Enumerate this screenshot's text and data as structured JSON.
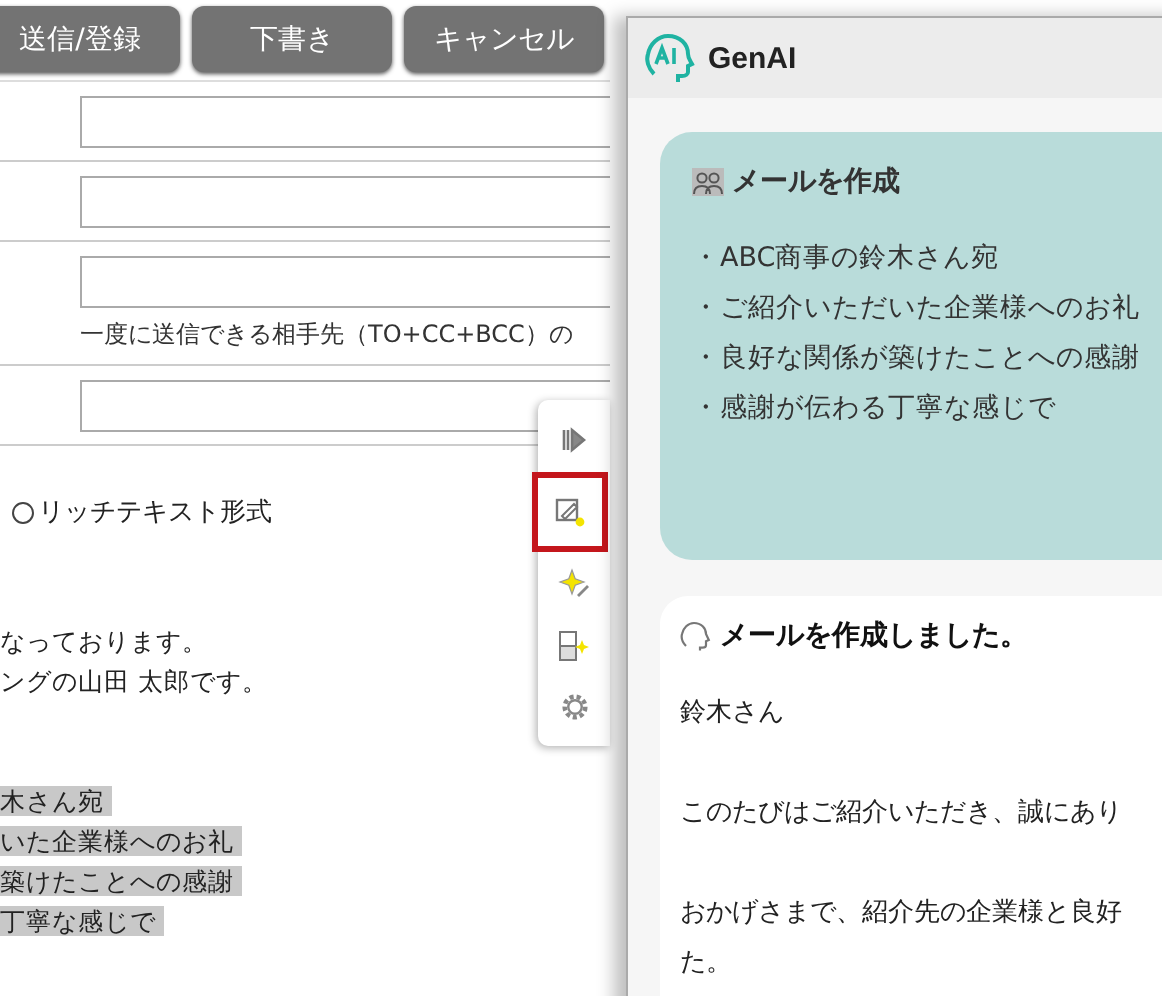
{
  "action_buttons": [
    "送信/登録",
    "下書き",
    "キャンセル"
  ],
  "fields": [
    {
      "kind": "text"
    },
    {
      "kind": "text"
    },
    {
      "kind": "text",
      "note": "一度に送信できる相手先（TO+CC+BCC）の"
    },
    {
      "kind": "text"
    }
  ],
  "format_option": {
    "label": "リッチテキスト形式",
    "selected": false
  },
  "body_paragraphs": [
    [
      {
        "text": "なっております。",
        "selected": false
      },
      {
        "text": "ングの山田 太郎です。",
        "selected": false
      }
    ],
    [
      {
        "text": "木さん宛",
        "selected": true
      },
      {
        "text": "いた企業様へのお礼",
        "selected": true
      },
      {
        "text": "築けたことへの感謝",
        "selected": true
      },
      {
        "text": "丁寧な感じで",
        "selected": true
      }
    ]
  ],
  "side_tools": [
    {
      "kind": "collapse",
      "selected": false
    },
    {
      "kind": "compose",
      "selected": true
    },
    {
      "kind": "sparkle",
      "selected": false
    },
    {
      "kind": "translate",
      "selected": false
    },
    {
      "kind": "settings",
      "selected": false
    }
  ],
  "panel": {
    "title": "GenAI",
    "request": {
      "title": "メールを作成",
      "items": [
        "・ABC商事の鈴木さん宛",
        "・ご紹介いただいた企業様へのお礼",
        "・良好な関係が築けたことへの感謝",
        "・感謝が伝わる丁寧な感じで"
      ]
    },
    "response": {
      "title": "メールを作成しました。",
      "paragraphs": [
        [
          "鈴木さん"
        ],
        [
          "このたびはご紹介いただき、誠にあり"
        ],
        [
          "おかげさまで、紹介先の企業様と良好",
          "た。"
        ]
      ]
    }
  }
}
